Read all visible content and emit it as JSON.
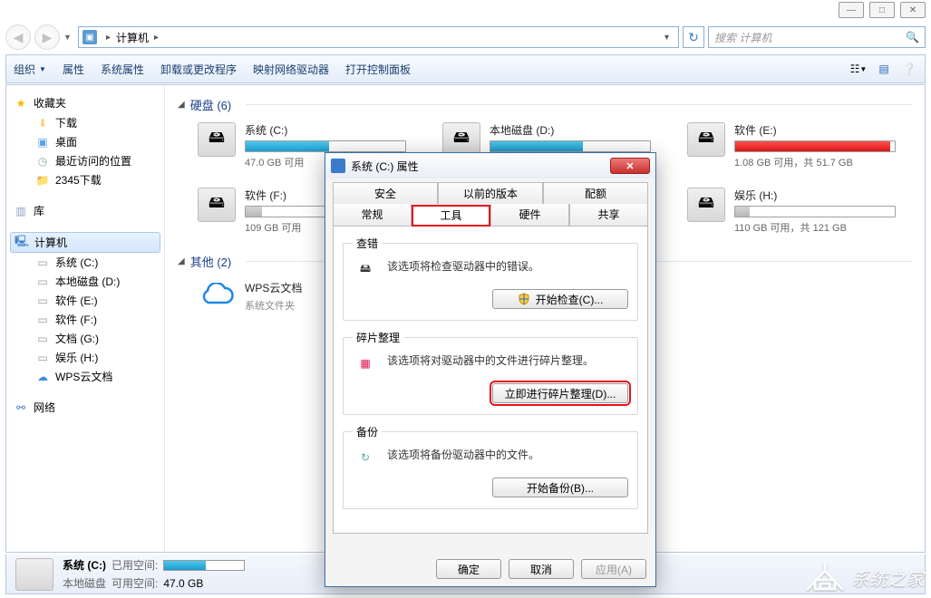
{
  "window_controls": {
    "min": "—",
    "max": "□",
    "close": "✕"
  },
  "nav": {
    "crumb_root": "计算机",
    "refresh": "↻"
  },
  "search": {
    "placeholder": "搜索 计算机"
  },
  "toolbar": {
    "organize": "组织",
    "properties": "属性",
    "system_properties": "系统属性",
    "uninstall": "卸载或更改程序",
    "map_drive": "映射网络驱动器",
    "control_panel": "打开控制面板"
  },
  "sidebar": {
    "favorites": "收藏夹",
    "downloads": "下载",
    "desktop": "桌面",
    "recent": "最近访问的位置",
    "folder2345": "2345下载",
    "libraries": "库",
    "computer": "计算机",
    "drive_c": "系统 (C:)",
    "drive_d": "本地磁盘 (D:)",
    "drive_e": "软件 (E:)",
    "drive_f": "软件 (F:)",
    "drive_g": "文档 (G:)",
    "drive_h": "娱乐 (H:)",
    "wps": "WPS云文档",
    "network": "网络"
  },
  "content": {
    "group_drives": "硬盘 (6)",
    "group_other": "其他 (2)",
    "wps_name": "WPS云文档",
    "wps_sub": "系统文件夹",
    "drives": {
      "c": {
        "name": "系统 (C:)",
        "stat": "47.0 GB 可用",
        "fill": 52,
        "color": "blue"
      },
      "d": {
        "name": "本地磁盘 (D:)",
        "stat": "",
        "fill": 58,
        "color": "blue"
      },
      "e": {
        "name": "软件 (E:)",
        "stat": "1.08 GB 可用，共 51.7 GB",
        "fill": 97,
        "color": "red"
      },
      "f": {
        "name": "软件 (F:)",
        "stat": "109 GB 可用",
        "fill": 10,
        "color": "grey"
      },
      "h": {
        "name": "娱乐 (H:)",
        "stat": "110 GB 可用，共 121 GB",
        "fill": 9,
        "color": "grey"
      }
    }
  },
  "details": {
    "name": "系统 (C:)",
    "sub": "本地磁盘",
    "used_label": "已用空间:",
    "free_label": "可用空间:",
    "free_value": "47.0 GB"
  },
  "dialog": {
    "title": "系统 (C:) 属性",
    "tabs": {
      "security": "安全",
      "prev": "以前的版本",
      "quota": "配额",
      "general": "常规",
      "tools": "工具",
      "hardware": "硬件",
      "sharing": "共享"
    },
    "check": {
      "legend": "查错",
      "desc": "该选项将检查驱动器中的错误。",
      "btn": "开始检查(C)..."
    },
    "defrag": {
      "legend": "碎片整理",
      "desc": "该选项将对驱动器中的文件进行碎片整理。",
      "btn": "立即进行碎片整理(D)..."
    },
    "backup": {
      "legend": "备份",
      "desc": "该选项将备份驱动器中的文件。",
      "btn": "开始备份(B)..."
    },
    "ok": "确定",
    "cancel": "取消",
    "apply": "应用(A)"
  },
  "watermark": "系统之家"
}
